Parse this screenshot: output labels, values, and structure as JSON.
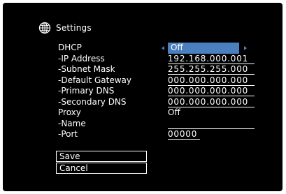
{
  "header": {
    "title": "Settings",
    "icon": "globe-icon"
  },
  "fields": [
    {
      "label": "DHCP",
      "value": "Off"
    },
    {
      "label": "-IP Address",
      "value": "192.168.000.001"
    },
    {
      "label": "-Subnet Mask",
      "value": "255.255.255.000"
    },
    {
      "label": "-Default Gateway",
      "value": "000.000.000.000"
    },
    {
      "label": "-Primary DNS",
      "value": "000.000.000.000"
    },
    {
      "label": "-Secondary DNS",
      "value": "000.000.000.000"
    },
    {
      "label": "Proxy",
      "value": "Off"
    },
    {
      "label": "-Name",
      "value": ""
    },
    {
      "label": "-Port",
      "value": "00000"
    }
  ],
  "buttons": {
    "save": "Save",
    "cancel": "Cancel"
  },
  "colors": {
    "background": "#000000",
    "text": "#ffffff",
    "highlight": "#4a7fc0"
  }
}
